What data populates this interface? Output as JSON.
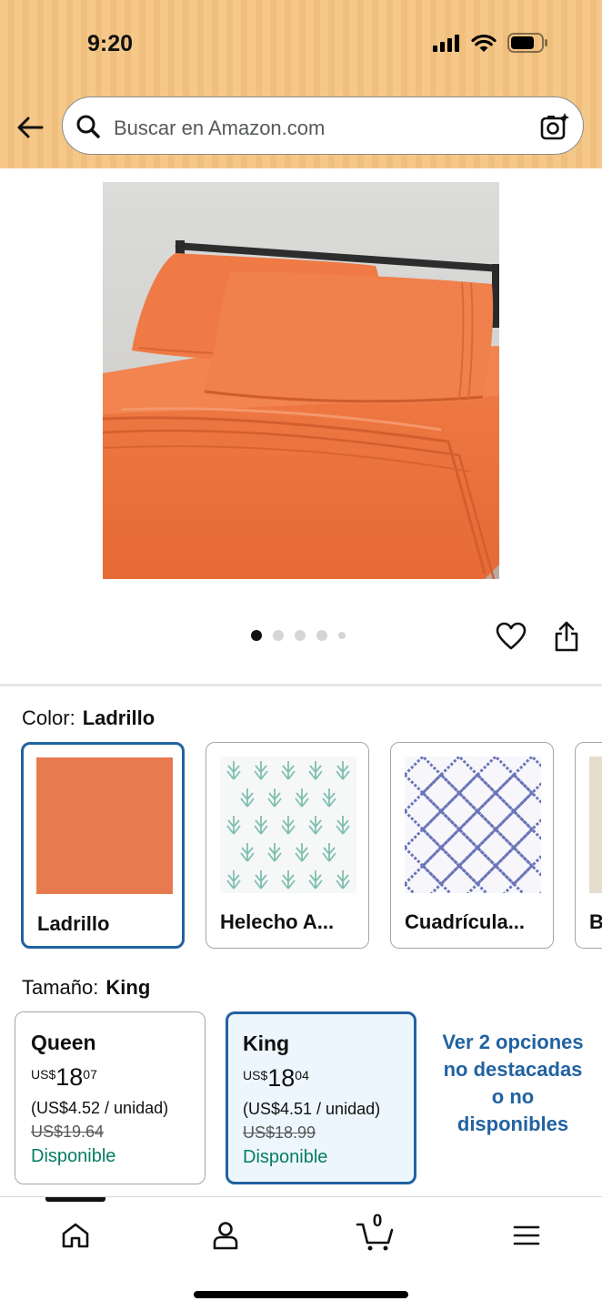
{
  "status_bar": {
    "time": "9:20"
  },
  "search": {
    "placeholder": "Buscar en Amazon.com"
  },
  "product": {
    "image_description": "orange sheet set on bed",
    "image_count": 5,
    "current_image": 1
  },
  "color": {
    "label": "Color:",
    "selected": "Ladrillo",
    "options": [
      {
        "name": "Ladrillo",
        "color": "#e77a4f"
      },
      {
        "name": "Helecho A...",
        "color": "#6fb5a6"
      },
      {
        "name": "Cuadrícula...",
        "color": "#6a74b8"
      },
      {
        "name": "B",
        "color": "#e6ddcc"
      }
    ]
  },
  "size": {
    "label": "Tamaño:",
    "selected": "King",
    "options": [
      {
        "name": "Queen",
        "price_currency": "US$",
        "price_whole": "18",
        "price_fraction": "07",
        "unit_price": "(US$4.52 / unidad)",
        "list_price": "US$19.64",
        "availability": "Disponible"
      },
      {
        "name": "King",
        "price_currency": "US$",
        "price_whole": "18",
        "price_fraction": "04",
        "unit_price": "(US$4.51 / unidad)",
        "list_price": "US$18.99",
        "availability": "Disponible"
      }
    ],
    "more_options": "Ver 2 opciones no destacadas o no disponibles"
  },
  "bottom_nav": {
    "items": [
      "home-icon",
      "account-icon",
      "cart-icon",
      "menu-icon"
    ],
    "cart_count": "0"
  },
  "colors": {
    "accent_blue": "#2162a1",
    "available_green": "#067d62",
    "header_bg": "#f5c88a"
  }
}
